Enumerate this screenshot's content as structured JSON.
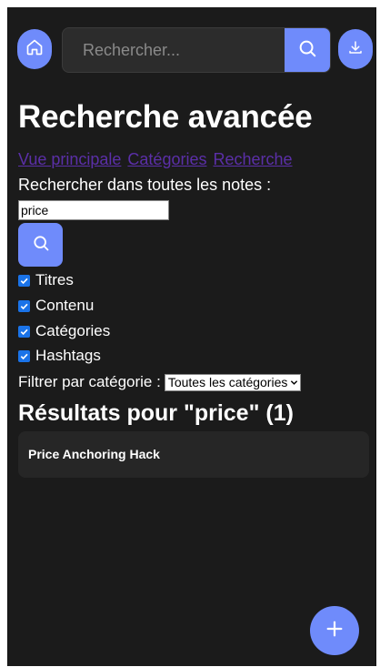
{
  "header": {
    "search_placeholder": "Rechercher..."
  },
  "page": {
    "title": "Recherche avancée",
    "nav_links": [
      "Vue principale",
      "Catégories",
      "Recherche"
    ],
    "search_label": "Rechercher dans toutes les notes :",
    "query_value": "price"
  },
  "options": [
    {
      "label": "Titres",
      "checked": true
    },
    {
      "label": "Contenu",
      "checked": true
    },
    {
      "label": "Catégories",
      "checked": true
    },
    {
      "label": "Hashtags",
      "checked": true
    }
  ],
  "filter": {
    "label": "Filtrer par catégorie :",
    "selected": "Toutes les catégories"
  },
  "results": {
    "heading": "Résultats pour \"price\" (1)",
    "items": [
      {
        "title": "Price Anchoring Hack"
      }
    ]
  },
  "colors": {
    "accent": "#6f8bfb",
    "background": "#1b1b1b",
    "card": "#262626",
    "link_visited": "#5b2fa8"
  },
  "icons": {
    "home": "home-icon",
    "search": "search-icon",
    "download": "download-icon",
    "add": "plus-icon"
  }
}
